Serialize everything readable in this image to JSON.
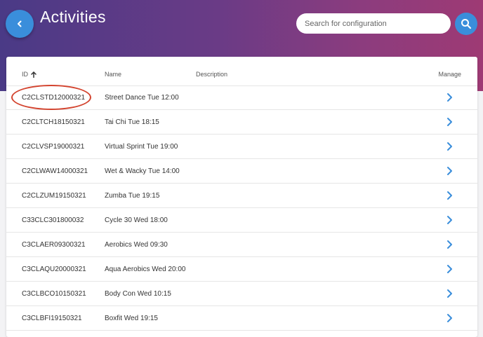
{
  "header": {
    "title": "Activities",
    "search_placeholder": "Search for configuration"
  },
  "table": {
    "columns": {
      "id": "ID",
      "name": "Name",
      "description": "Description",
      "manage": "Manage"
    },
    "sort_icon": "arrow-up-icon",
    "rows": [
      {
        "id": "C2CLSTD12000321",
        "name": "Street Dance Tue 12:00"
      },
      {
        "id": "C2CLTCH18150321",
        "name": "Tai Chi Tue 18:15"
      },
      {
        "id": "C2CLVSP19000321",
        "name": "Virtual Sprint Tue 19:00"
      },
      {
        "id": "C2CLWAW14000321",
        "name": "Wet & Wacky Tue 14:00"
      },
      {
        "id": "C2CLZUM19150321",
        "name": "Zumba Tue 19:15"
      },
      {
        "id": "C33CLC301800032",
        "name": "Cycle 30 Wed 18:00"
      },
      {
        "id": "C3CLAER09300321",
        "name": "Aerobics Wed 09:30"
      },
      {
        "id": "C3CLAQU20000321",
        "name": "Aqua Aerobics Wed 20:00"
      },
      {
        "id": "C3CLBCO10150321",
        "name": "Body Con Wed 10:15"
      },
      {
        "id": "C3CLBFI19150321",
        "name": "Boxfit Wed 19:15"
      }
    ]
  },
  "colors": {
    "accent": "#3a8edb",
    "highlight": "#d3442f",
    "banner_start": "#4a3a86",
    "banner_end": "#9e3a74"
  },
  "icons": {
    "back": "chevron-left-icon",
    "search": "search-icon",
    "manage": "chevron-right-icon"
  }
}
